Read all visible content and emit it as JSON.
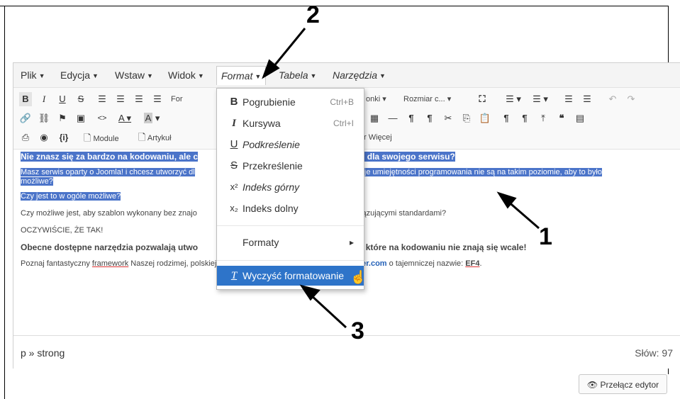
{
  "menubar": {
    "items": [
      {
        "label": "Plik"
      },
      {
        "label": "Edycja"
      },
      {
        "label": "Wstaw"
      },
      {
        "label": "Widok"
      },
      {
        "label": "Format"
      },
      {
        "label": "Tabela"
      },
      {
        "label": "Narzędzia"
      }
    ]
  },
  "toolbar": {
    "font_label": "For",
    "tab_fragment": "onki",
    "font_size": "Rozmiar c...",
    "more": "r Więcej",
    "module_btn": "Module",
    "article_btn": "Artykuł",
    "braces": "{i}"
  },
  "format_menu": {
    "items": [
      {
        "icon": "B",
        "label": "Pogrubienie",
        "shortcut": "Ctrl+B"
      },
      {
        "icon": "I",
        "label": "Kursywa",
        "shortcut": "Ctrl+I"
      },
      {
        "icon": "U",
        "label": "Podkreślenie",
        "shortcut": ""
      },
      {
        "icon": "S",
        "label": "Przekreślenie",
        "shortcut": ""
      },
      {
        "icon": "x²",
        "label": "Indeks górny",
        "shortcut": ""
      },
      {
        "icon": "x₂",
        "label": "Indeks dolny",
        "shortcut": ""
      }
    ],
    "formats": "Formaty",
    "clear": "Wyczyść formatowanie"
  },
  "content": {
    "p1a": "Nie znasz się za bardzo na kodowaniu, ale c",
    "p1b": "blon dla swojego serwisu?",
    "p2a": "Masz serwis oparty o Joomla! i chcesz utworzyć dl",
    "p2b": "e Twoje umiejętności programowania nie są na takim poziomie, aby to było",
    "p2c": "możliwe?",
    "p3": "Czy jest to w ogóle możliwe?",
    "p4a": "Czy możliwe jest, aby szablon wykonany bez znajo",
    "p4b": "bowiązującymi standardami?",
    "p5": "OCZYWIŚCIE, ŻE TAK!",
    "p6a": "Obecne dostępne narzędzia pozwalają utwo",
    "p6b": "om, które na kodowaniu nie znają się wcale!",
    "p7a": "Poznaj fantastyczny ",
    "p7b": "framework",
    "p7c": " Naszej rodzimej, polskiej produkcji, prosto ze stajni ",
    "p7d": "Joomla-Monster.com",
    "p7e": " o tajemniczej nazwie: ",
    "p7f": "EF4",
    "p7g": "."
  },
  "status": {
    "path": "p » strong",
    "words": "Słów: 97"
  },
  "switch_editor": "Przełącz edytor",
  "callouts": {
    "one": "1",
    "two": "2",
    "three": "3"
  }
}
